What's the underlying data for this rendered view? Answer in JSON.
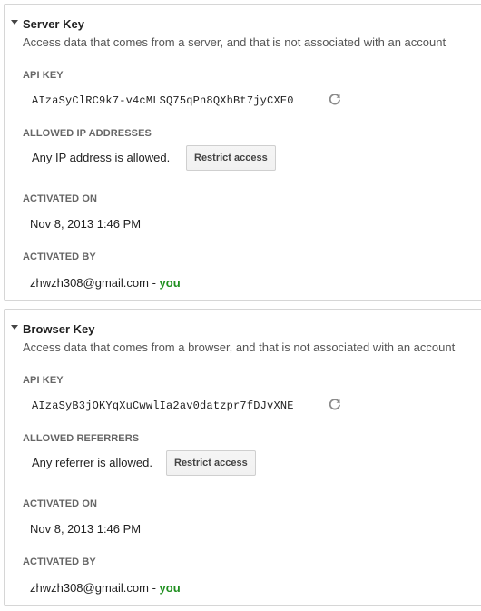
{
  "server_key": {
    "title": "Server Key",
    "description": "Access data that comes from a server, and that is not associated with an account",
    "api_key_label": "API KEY",
    "api_key": "AIzaSyClRC9k7-v4cMLSQ75qPn8QXhBt7jyCXE0",
    "allowed_label": "ALLOWED IP ADDRESSES",
    "allowed_text": "Any IP address is allowed.",
    "restrict_label": "Restrict access",
    "activated_on_label": "ACTIVATED ON",
    "activated_on": "Nov 8, 2013 1:46 PM",
    "activated_by_label": "ACTIVATED BY",
    "activated_by_email": "zhwzh308@gmail.com",
    "activated_by_separator": " - ",
    "activated_by_you": "you"
  },
  "browser_key": {
    "title": "Browser Key",
    "description": "Access data that comes from a browser, and that is not associated with an account",
    "api_key_label": "API KEY",
    "api_key": "AIzaSyB3jOKYqXuCwwlIa2av0datzpr7fDJvXNE",
    "allowed_label": "ALLOWED REFERRERS",
    "allowed_text": "Any referrer is allowed.",
    "restrict_label": "Restrict access",
    "activated_on_label": "ACTIVATED ON",
    "activated_on": "Nov 8, 2013 1:46 PM",
    "activated_by_label": "ACTIVATED BY",
    "activated_by_email": "zhwzh308@gmail.com",
    "activated_by_separator": " - ",
    "activated_by_you": "you"
  },
  "icons": {
    "toggle": "triangle-down-icon",
    "regenerate": "refresh-icon"
  },
  "colors": {
    "you": "#1f8f1f",
    "label": "#666666",
    "border": "#d6d6d6"
  }
}
